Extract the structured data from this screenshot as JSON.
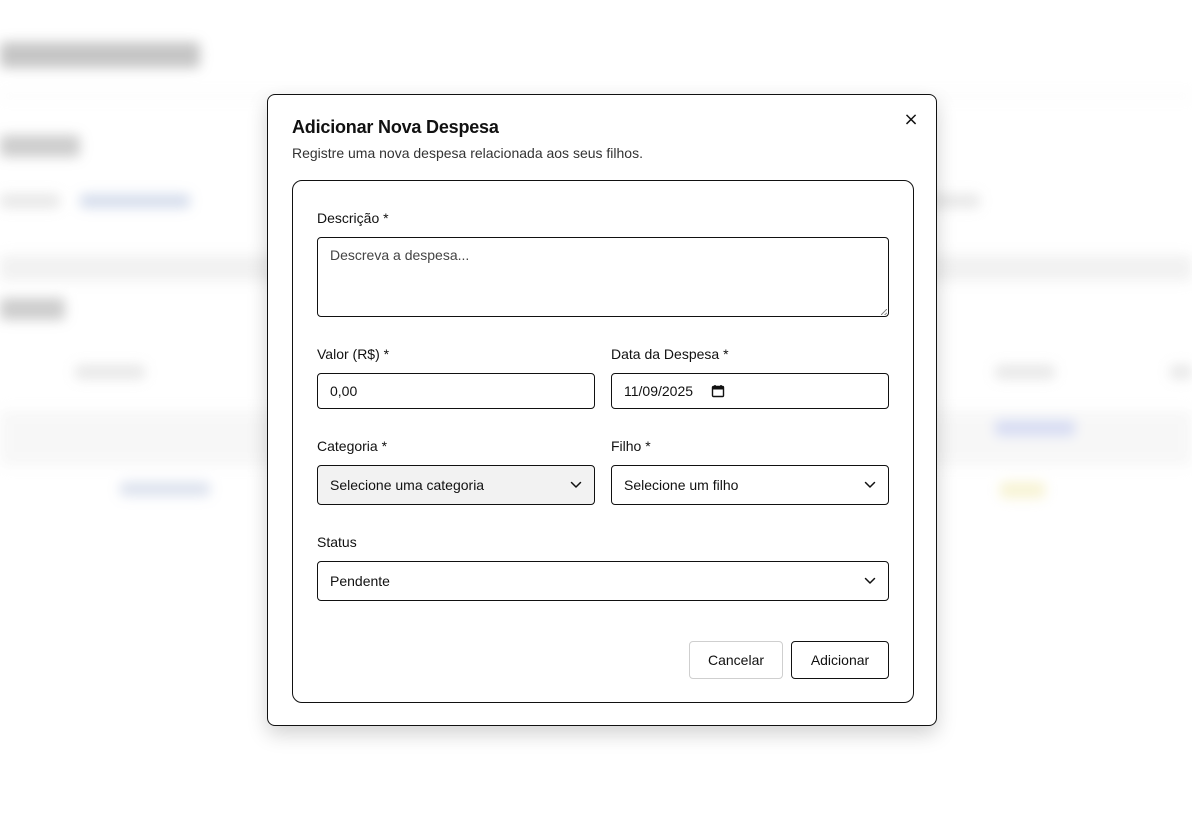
{
  "dialog": {
    "title": "Adicionar Nova Despesa",
    "description": "Registre uma nova despesa relacionada aos seus filhos.",
    "close_symbol": "×"
  },
  "form": {
    "descricao": {
      "label": "Descrição *",
      "placeholder": "Descreva a despesa..."
    },
    "valor": {
      "label": "Valor (R$) *",
      "value": "0,00"
    },
    "data": {
      "label": "Data da Despesa *",
      "value": "11/09/2025",
      "icon": "calendar-icon"
    },
    "categoria": {
      "label": "Categoria *",
      "selected": "Selecione uma categoria"
    },
    "filho": {
      "label": "Filho *",
      "selected": "Selecione um filho"
    },
    "status": {
      "label": "Status",
      "selected": "Pendente"
    }
  },
  "actions": {
    "cancel_label": "Cancelar",
    "submit_label": "Adicionar"
  }
}
